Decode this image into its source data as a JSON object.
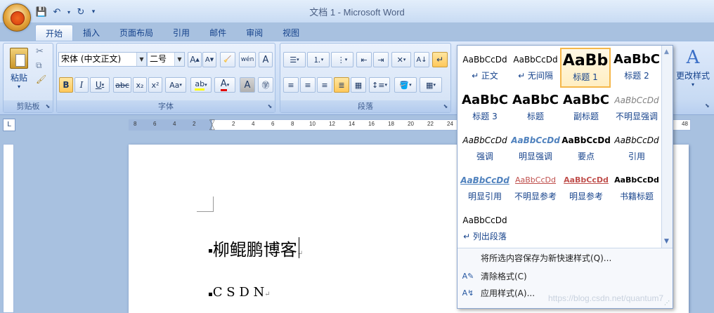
{
  "window": {
    "title": "文档 1 - Microsoft Word"
  },
  "tabs": [
    "开始",
    "插入",
    "页面布局",
    "引用",
    "邮件",
    "审阅",
    "视图"
  ],
  "clipboard": {
    "paste_label": "粘贴",
    "group_label": "剪贴板"
  },
  "font": {
    "name": "宋体 (中文正文)",
    "size": "二号",
    "group_label": "字体",
    "bold": "B",
    "italic": "I",
    "underline": "U",
    "strike": "abc",
    "sub": "x₂",
    "sup": "x²",
    "case": "Aa",
    "phonetic": "wén",
    "char_border": "A"
  },
  "paragraph": {
    "group_label": "段落"
  },
  "styles_menu": {
    "items": [
      {
        "sample": "AaBbCcDd",
        "name": "↵ 正文"
      },
      {
        "sample": "AaBbCcDd",
        "name": "↵ 无间隔"
      },
      {
        "sample": "AaBb",
        "name": "标题 1"
      },
      {
        "sample": "AaBbC",
        "name": "标题 2"
      },
      {
        "sample": "AaBbC",
        "name": "标题 3"
      },
      {
        "sample": "AaBbC",
        "name": "标题"
      },
      {
        "sample": "AaBbC",
        "name": "副标题"
      },
      {
        "sample": "AaBbCcDd",
        "name": "不明显强调"
      },
      {
        "sample": "AaBbCcDd",
        "name": "强调"
      },
      {
        "sample": "AaBbCcDd",
        "name": "明显强调"
      },
      {
        "sample": "AaBbCcDd",
        "name": "要点"
      },
      {
        "sample": "AaBbCcDd",
        "name": "引用"
      },
      {
        "sample": "AaBbCcDd",
        "name": "明显引用"
      },
      {
        "sample": "AaBbCcDd",
        "name": "不明显参考"
      },
      {
        "sample": "AaBbCcDd",
        "name": "明显参考"
      },
      {
        "sample": "AaBbCcDd",
        "name": "书籍标题"
      },
      {
        "sample": "AaBbCcDd",
        "name": "↵ 列出段落"
      }
    ],
    "selected": "标题 1",
    "save_selection": "将所选内容保存为新快速样式(Q)...",
    "clear_formatting": "清除格式(C)",
    "apply_styles": "应用样式(A)..."
  },
  "change_styles": {
    "label": "更改样式"
  },
  "ruler": {
    "ticks": [
      "8",
      "6",
      "4",
      "2",
      "2",
      "4",
      "6",
      "8",
      "10",
      "12",
      "14",
      "16",
      "18",
      "20",
      "22",
      "24",
      "48"
    ]
  },
  "document": {
    "paragraphs": [
      "柳鲲鹏博客",
      "C S D N"
    ]
  },
  "watermark": "https://blog.csdn.net/quantum7"
}
